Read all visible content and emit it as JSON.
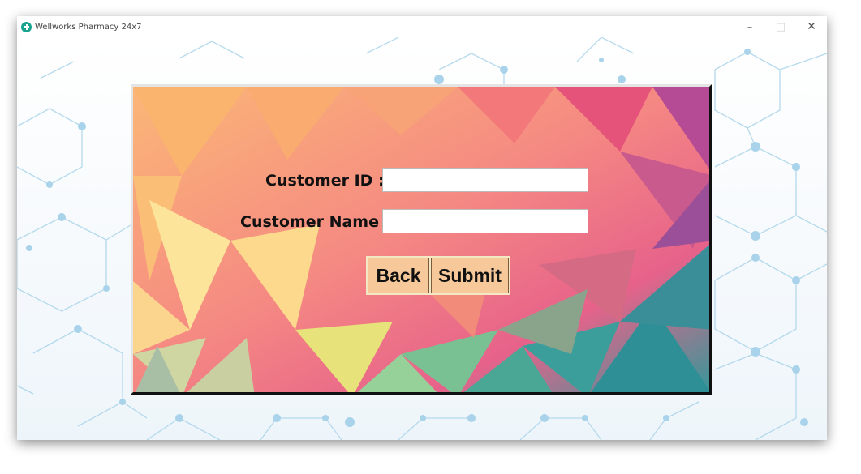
{
  "window": {
    "title": "Wellworks Pharmacy 24x7",
    "controls": {
      "minimize": "–",
      "maximize": "□",
      "close": "✕"
    }
  },
  "form": {
    "customer_id_label": "Customer ID :",
    "customer_id_value": "",
    "customer_name_label": "Customer Name :",
    "customer_name_value": "",
    "back_label": "Back",
    "submit_label": "Submit"
  },
  "icons": {
    "app": "pharmacy-cross-icon"
  },
  "colors": {
    "accent_teal": "#1aa38f",
    "button_fill": "#f7c99a",
    "background_lines": "#a9d3ea"
  }
}
